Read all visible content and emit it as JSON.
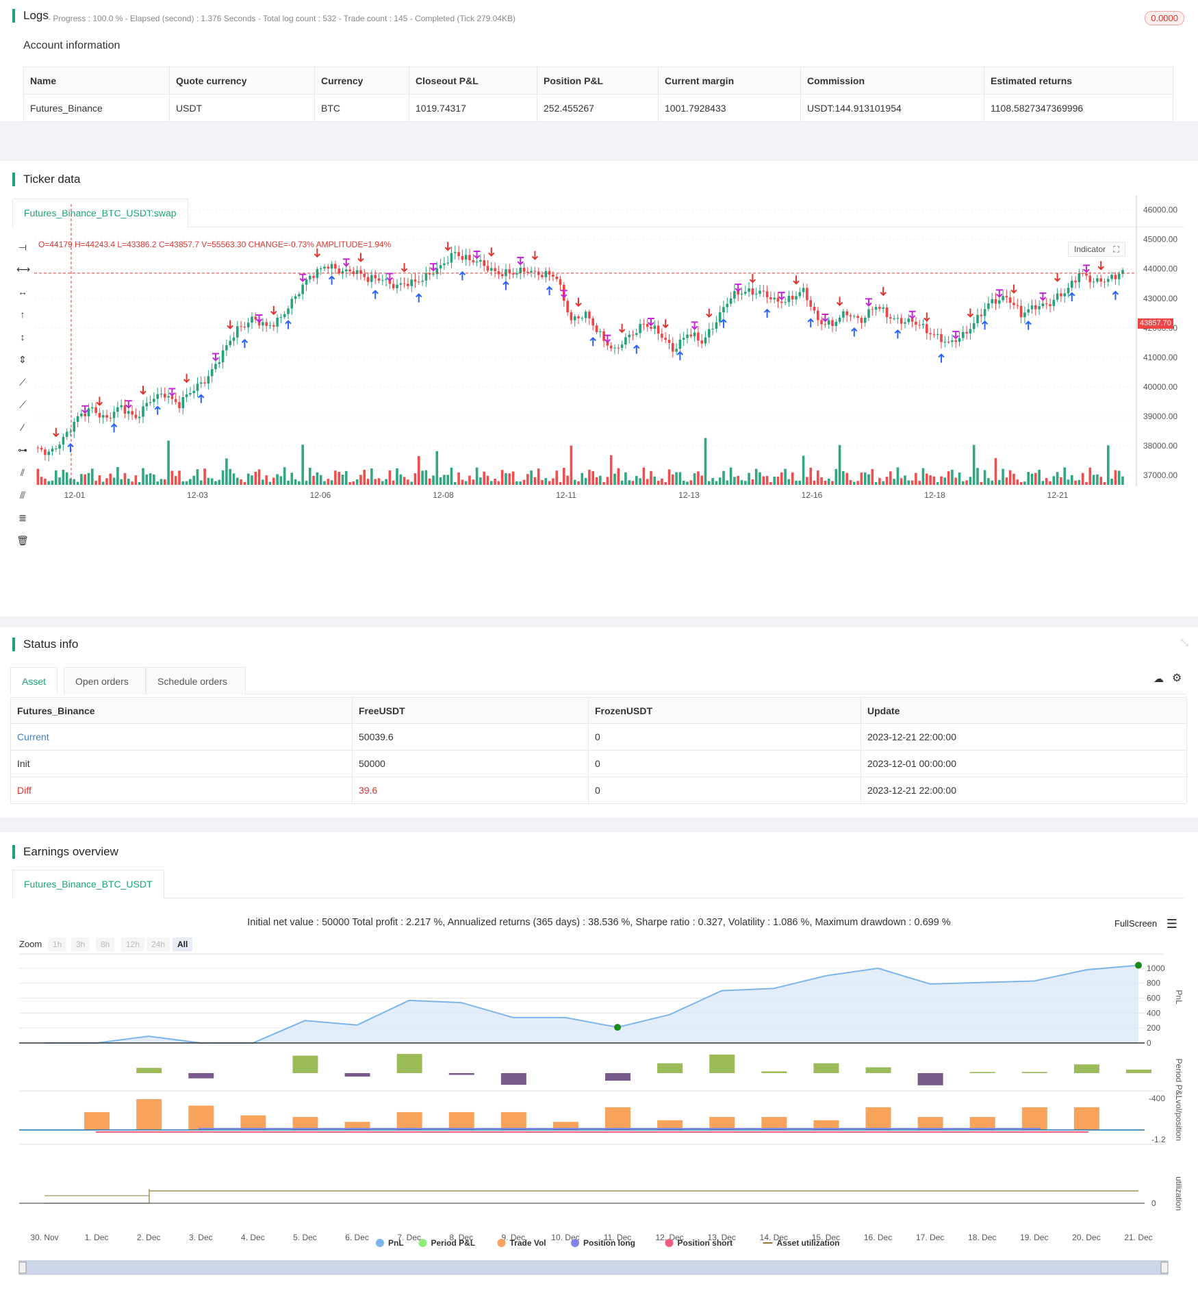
{
  "logs": {
    "title": "Logs",
    "meta": "- Progress : 100.0 % - Elapsed (second) : 1.376  Seconds - Total log count : 532 - Trade count : 145 - Completed (Tick 279.04KB)",
    "badge": "0.0000"
  },
  "account": {
    "title": "Account information",
    "headers": [
      "Name",
      "Quote currency",
      "Currency",
      "Closeout P&L",
      "Position P&L",
      "Current margin",
      "Commission",
      "Estimated returns"
    ],
    "row": [
      "Futures_Binance",
      "USDT",
      "BTC",
      "1019.74317",
      "252.455267",
      "1001.7928433",
      "USDT:144.913101954",
      "1108.5827347369996"
    ]
  },
  "ticker": {
    "title": "Ticker data",
    "tab": "Futures_Binance_BTC_USDT:swap",
    "ohlc": "O=44179 H=44243.4 L=43386.2 C=43857.7 V=55563.30 CHANGE=-0.73% AMPLITUDE=1.94%",
    "indicator_btn": "Indicator",
    "last_price": "43857.70",
    "colors": {
      "up": "#26a17b",
      "down": "#ef4444",
      "short": "#e0332e",
      "long": "#2962ff",
      "close": "#c026d3"
    }
  },
  "chart_data": [
    {
      "type": "candlestick",
      "title": "",
      "y_ticks": [
        "46000.00",
        "45000.00",
        "44000.00",
        "43000.00",
        "42000.00",
        "41000.00",
        "40000.00",
        "39000.00",
        "38000.00",
        "37000.00"
      ],
      "ylim": [
        36700,
        46200
      ],
      "x_ticks": [
        "12-01",
        "12-03",
        "12-06",
        "12-08",
        "12-11",
        "12-13",
        "12-16",
        "12-18",
        "12-21"
      ],
      "anchors": [
        [
          0,
          37900
        ],
        [
          4,
          37700
        ],
        [
          8,
          38300
        ],
        [
          12,
          38900
        ],
        [
          16,
          39300
        ],
        [
          20,
          38900
        ],
        [
          24,
          39300
        ],
        [
          28,
          39000
        ],
        [
          32,
          39500
        ],
        [
          36,
          39800
        ],
        [
          40,
          39400
        ],
        [
          44,
          39900
        ],
        [
          48,
          40400
        ],
        [
          52,
          41100
        ],
        [
          56,
          42000
        ],
        [
          60,
          42300
        ],
        [
          64,
          42000
        ],
        [
          68,
          42400
        ],
        [
          72,
          43000
        ],
        [
          76,
          43800
        ],
        [
          80,
          44100
        ],
        [
          84,
          43900
        ],
        [
          88,
          44000
        ],
        [
          92,
          43600
        ],
        [
          96,
          43700
        ],
        [
          100,
          43400
        ],
        [
          104,
          43500
        ],
        [
          108,
          43800
        ],
        [
          112,
          44000
        ],
        [
          116,
          44600
        ],
        [
          120,
          44300
        ],
        [
          124,
          44100
        ],
        [
          128,
          43900
        ],
        [
          132,
          43800
        ],
        [
          136,
          44000
        ],
        [
          140,
          43800
        ],
        [
          144,
          43700
        ],
        [
          148,
          42300
        ],
        [
          152,
          42400
        ],
        [
          156,
          41800
        ],
        [
          160,
          41200
        ],
        [
          164,
          41700
        ],
        [
          168,
          42200
        ],
        [
          172,
          41800
        ],
        [
          176,
          41300
        ],
        [
          180,
          41800
        ],
        [
          184,
          41500
        ],
        [
          188,
          42300
        ],
        [
          192,
          43000
        ],
        [
          196,
          43300
        ],
        [
          200,
          43200
        ],
        [
          204,
          42900
        ],
        [
          208,
          43000
        ],
        [
          212,
          43200
        ],
        [
          216,
          42300
        ],
        [
          220,
          42100
        ],
        [
          224,
          42500
        ],
        [
          228,
          42300
        ],
        [
          232,
          42700
        ],
        [
          236,
          42400
        ],
        [
          240,
          42200
        ],
        [
          244,
          42100
        ],
        [
          248,
          41800
        ],
        [
          252,
          41400
        ],
        [
          256,
          41800
        ],
        [
          260,
          42300
        ],
        [
          264,
          42900
        ],
        [
          268,
          43100
        ],
        [
          272,
          42400
        ],
        [
          276,
          42800
        ],
        [
          280,
          42800
        ],
        [
          284,
          43200
        ],
        [
          288,
          43900
        ],
        [
          292,
          43500
        ],
        [
          296,
          43700
        ],
        [
          300,
          43900
        ]
      ]
    },
    {
      "type": "area",
      "title": "",
      "y_ticks": [
        "1000",
        "800",
        "600",
        "400",
        "200",
        "0"
      ],
      "ylim": [
        0,
        1100
      ],
      "x_ticks": [
        "30. Nov",
        "1. Dec",
        "2. Dec",
        "3. Dec",
        "4. Dec",
        "5. Dec",
        "6. Dec",
        "7. Dec",
        "8. Dec",
        "9. Dec",
        "10. Dec",
        "11. Dec",
        "12. Dec",
        "13. Dec",
        "14. Dec",
        "15. Dec",
        "16. Dec",
        "17. Dec",
        "18. Dec",
        "19. Dec",
        "20. Dec",
        "21. Dec"
      ],
      "series": [
        {
          "name": "PnL",
          "values": [
            0,
            0,
            90,
            0,
            0,
            300,
            240,
            570,
            540,
            340,
            340,
            210,
            380,
            700,
            730,
            900,
            1000,
            790,
            810,
            830,
            980,
            1040
          ]
        }
      ]
    },
    {
      "type": "bar",
      "title": "",
      "ylabel": "Period P&L",
      "y_ticks": [
        "-400"
      ],
      "series": [
        {
          "name": "Period P&L",
          "values": [
            0,
            0,
            90,
            -90,
            0,
            300,
            -60,
            330,
            -30,
            -200,
            0,
            -130,
            170,
            320,
            30,
            170,
            100,
            -210,
            20,
            20,
            150,
            60
          ]
        }
      ]
    },
    {
      "type": "bar",
      "title": "",
      "y_ticks": [
        "-1.2"
      ],
      "series": [
        {
          "name": "Trade Vol",
          "values": [
            0,
            1.1,
            1.9,
            1.5,
            0.9,
            0.8,
            0.5,
            1.1,
            1.1,
            1.1,
            0.5,
            1.4,
            0.6,
            0.8,
            0.8,
            0.6,
            1.4,
            0.8,
            0.8,
            1.4,
            1.4,
            0
          ]
        }
      ]
    }
  ],
  "status": {
    "title": "Status info",
    "tabs": [
      "Asset",
      "Open orders",
      "Schedule orders"
    ],
    "headers": [
      "Futures_Binance",
      "FreeUSDT",
      "FrozenUSDT",
      "Update"
    ],
    "rows": [
      [
        "Current",
        "50039.6",
        "0",
        "2023-12-21 22:00:00"
      ],
      [
        "Init",
        "50000",
        "0",
        "2023-12-01 00:00:00"
      ],
      [
        "Diff",
        "39.6",
        "0",
        "2023-12-21 22:00:00"
      ]
    ]
  },
  "earnings": {
    "title": "Earnings overview",
    "tab": "Futures_Binance_BTC_USDT",
    "summary": "Initial net value : 50000 Total profit : 2.217 %, Annualized returns (365 days) : 38.536 %, Sharpe ratio : 0.327, Volatility : 1.086 %, Maximum drawdown : 0.699 %",
    "fullscreen": "FullScreen",
    "zoom_label": "Zoom",
    "zoom_options": [
      "1h",
      "3h",
      "8h",
      "12h",
      "24h",
      "All"
    ],
    "axis_titles": [
      "PnL",
      "Period P&L",
      "vol/position",
      "utilization"
    ],
    "legend": [
      "PnL",
      "Period P&L",
      "Trade Vol",
      "Position long",
      "Position short",
      "Asset utilization"
    ],
    "legend_colors": [
      "#7cb5ec",
      "#90ed7d",
      "#f7a35c",
      "#8085e9",
      "#f15c80",
      "#8d7a3a"
    ]
  }
}
